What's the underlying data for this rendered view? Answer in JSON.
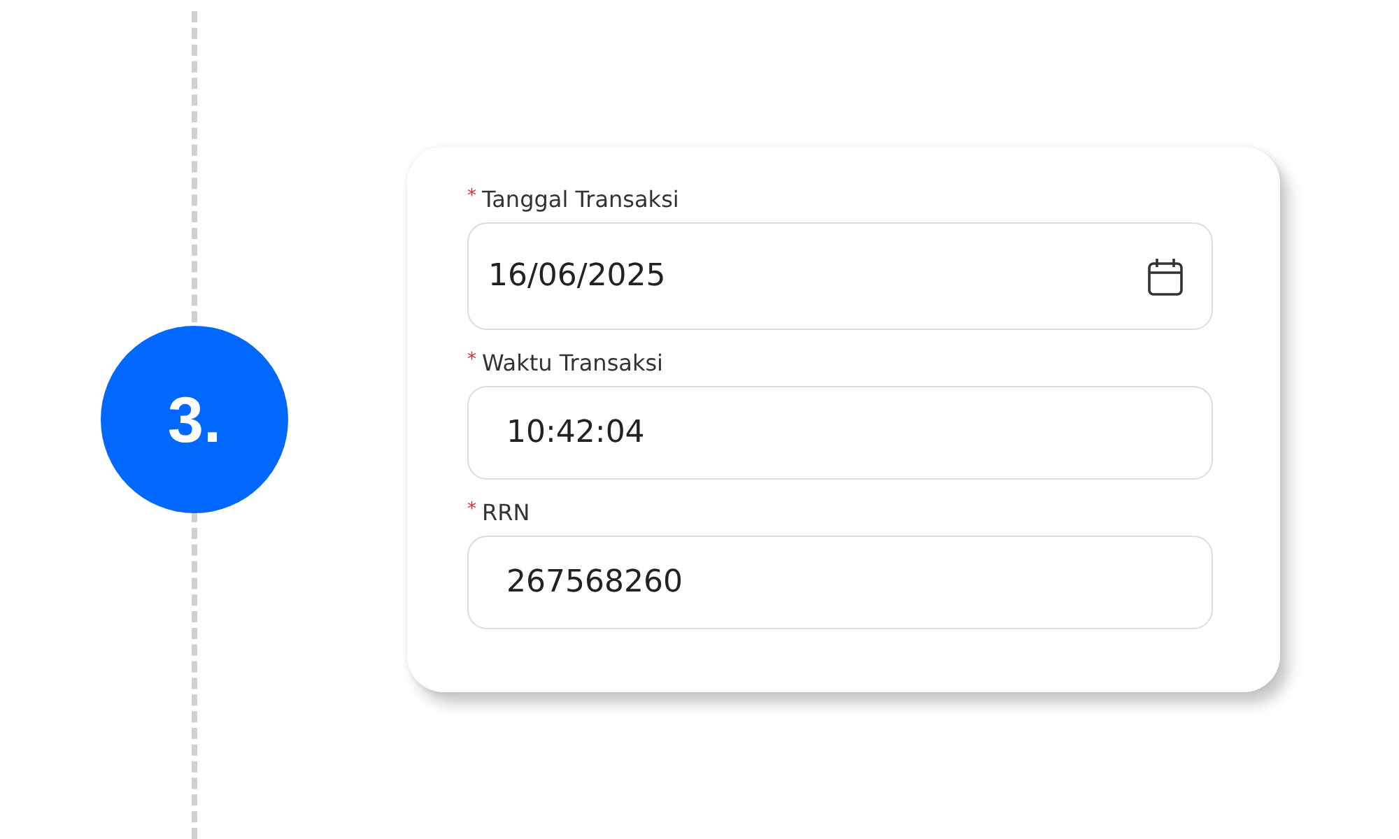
{
  "step": {
    "number": "3."
  },
  "form": {
    "fields": [
      {
        "kind": "date",
        "marker": "*",
        "label": "Tanggal Transaksi",
        "value": "16/06/2025"
      },
      {
        "kind": "text",
        "marker": "*",
        "label": "Waktu Transaksi",
        "value": "10:42:04"
      },
      {
        "kind": "text",
        "marker": "*",
        "label": "RRN",
        "value": "267568260"
      }
    ]
  }
}
